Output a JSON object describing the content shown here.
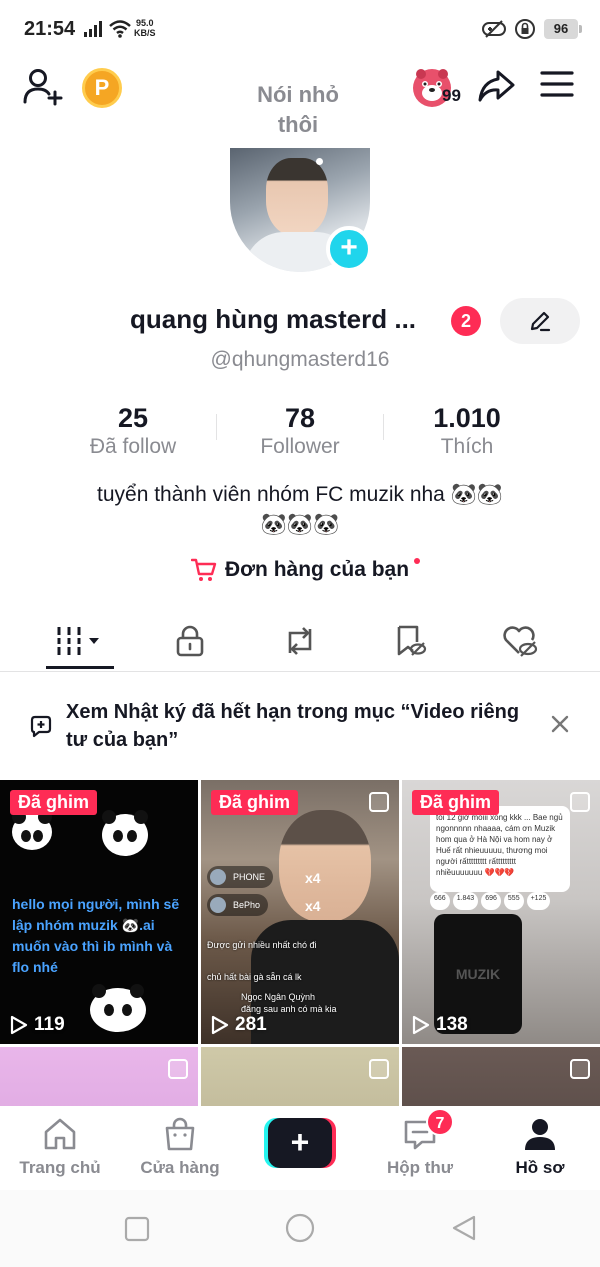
{
  "status_bar": {
    "time": "21:54",
    "net_speed_value": "95.0",
    "net_speed_unit": "KB/S",
    "battery": "96"
  },
  "header": {
    "title_line1": "Nói nhỏ",
    "title_line2": "thôi",
    "coin_label": "P",
    "mascot_count": "99"
  },
  "profile": {
    "display_name": "quang hùng masterd ...",
    "name_badge": "2",
    "handle": "@qhungmasterd16",
    "stats": [
      {
        "value": "25",
        "label": "Đã follow"
      },
      {
        "value": "78",
        "label": "Follower"
      },
      {
        "value": "1.010",
        "label": "Thích"
      }
    ],
    "bio_line1": "tuyển thành viên nhóm FC muzik nha 🐼🐼",
    "bio_line2": "🐼🐼🐼",
    "orders_label": "Đơn hàng của bạn"
  },
  "notice": {
    "text": "Xem Nhật ký đã hết hạn trong mục “Video riêng tư của bạn”"
  },
  "videos": [
    {
      "pinned_label": "Đã ghim",
      "views": "119",
      "caption": "hello mọi người, mình sẽ lập nhóm muzik 🐼.ai muốn vào thì ib mình và flo nhé"
    },
    {
      "pinned_label": "Đã ghim",
      "views": "281",
      "gift1_name": "PHONE",
      "gift1_count": "x4",
      "gift2_name": "BePho",
      "gift2_count": "x4",
      "comment1": "Được gửi nhiều nhất chó đi",
      "comment2": "chủ hất bài gà sẵn cá lk",
      "comment3": "Ngọc Ngân Quỳnh",
      "comment4": "đăng sau anh có mà kia"
    },
    {
      "pinned_label": "Đã ghim",
      "views": "138",
      "chat": "toi 12 giờ moiii xong kkk ... Bae ngủ ngonnnnn nhaaaa, cám ơn Muzik hom qua ở Hà Nội va hom nay ở Huế rất nhieuuuuu, thương moi người rấttttttttt rấttttttttt nhiềuuuuuuu 💔💔💔",
      "phone_text": "MUZIK",
      "stats": [
        "666",
        "1.843",
        "696",
        "555",
        "+125"
      ]
    },
    {
      "views": ""
    },
    {
      "views": ""
    },
    {
      "views": ""
    }
  ],
  "bottom_nav": {
    "items": [
      "Trang chủ",
      "Cửa hàng",
      "",
      "Hộp thư",
      "Hồ sơ"
    ],
    "inbox_badge": "7",
    "create_label": "+"
  },
  "colors": {
    "accent": "#fe2c55",
    "cyan": "#25f4ee",
    "text_primary": "#161823",
    "text_secondary": "#8a8b91"
  }
}
